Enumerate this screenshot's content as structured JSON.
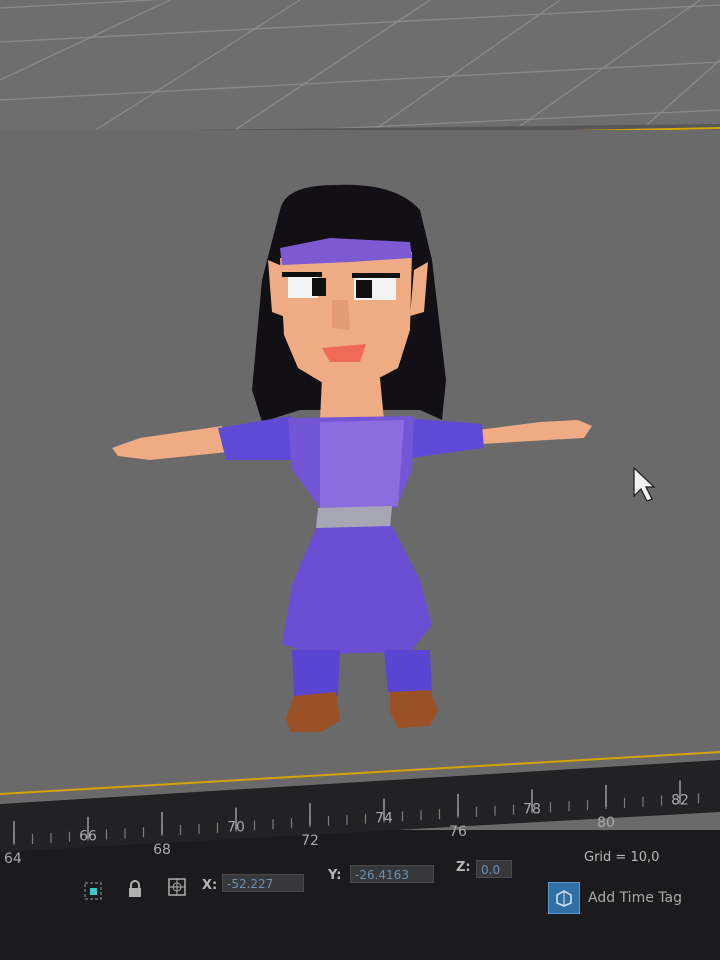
{
  "viewport": {
    "background": "#6a6a6b",
    "top_background": "#6e6e6f",
    "grid_line_color": "#8a8a8b",
    "selection_border_color": "#d4a400",
    "cursor_icon": "arrow-cursor-icon"
  },
  "character": {
    "hair_color": "#121014",
    "skin_color": "#efab84",
    "dress_color": "#6a4ed4",
    "belt_color": "#a6a6b5",
    "shoe_color": "#9a5125",
    "mouth_color": "#f06a55"
  },
  "timeline": {
    "ticks": [
      "64",
      "66",
      "68",
      "70",
      "72",
      "74",
      "76",
      "78",
      "80",
      "82"
    ],
    "frame_marker_color": "#d4a400"
  },
  "status_bar": {
    "icons": [
      "selection-lock-icon",
      "padlock-icon",
      "absolute-mode-icon"
    ],
    "x_label": "X:",
    "x_value": "-52.227",
    "y_label": "Y:",
    "y_value": "-26.4163",
    "z_label": "Z:",
    "z_value": "0.0",
    "grid_text": "Grid = 10,0",
    "time_tag_label": "Add Time Tag",
    "time_tag_icon": "time-tag-icon"
  }
}
